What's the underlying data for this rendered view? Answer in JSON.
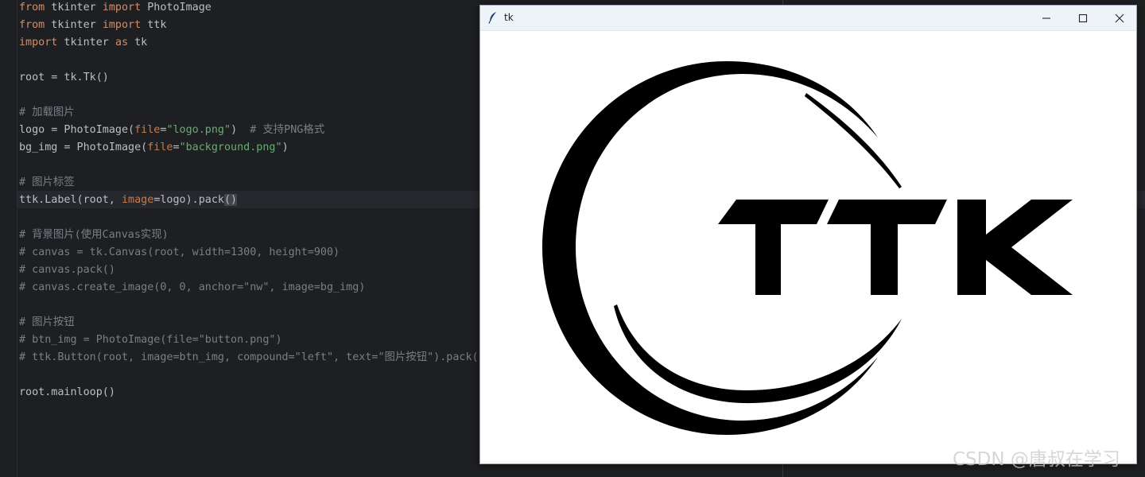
{
  "editor": {
    "lines": [
      [
        {
          "t": "from",
          "c": "kw"
        },
        {
          "t": " tkinter "
        },
        {
          "t": "import",
          "c": "kw"
        },
        {
          "t": " PhotoImage"
        }
      ],
      [
        {
          "t": "from",
          "c": "kw"
        },
        {
          "t": " tkinter "
        },
        {
          "t": "import",
          "c": "kw"
        },
        {
          "t": " ttk"
        }
      ],
      [
        {
          "t": "import",
          "c": "kw"
        },
        {
          "t": " tkinter "
        },
        {
          "t": "as",
          "c": "kw"
        },
        {
          "t": " tk"
        }
      ],
      [],
      [
        {
          "t": "root = tk.Tk()"
        }
      ],
      [],
      [
        {
          "t": "# 加载图片",
          "c": "cmt"
        }
      ],
      [
        {
          "t": "logo = PhotoImage("
        },
        {
          "t": "file",
          "c": "param"
        },
        {
          "t": "="
        },
        {
          "t": "\"logo.png\"",
          "c": "str"
        },
        {
          "t": ")  "
        },
        {
          "t": "# 支持PNG格式",
          "c": "cmt"
        }
      ],
      [
        {
          "t": "bg_img = PhotoImage("
        },
        {
          "t": "file",
          "c": "param"
        },
        {
          "t": "="
        },
        {
          "t": "\"background.png\"",
          "c": "str"
        },
        {
          "t": ")"
        }
      ],
      [],
      [
        {
          "t": "# 图片标签",
          "c": "cmt"
        }
      ],
      [
        {
          "t": "ttk.Label(root, "
        },
        {
          "t": "image",
          "c": "param"
        },
        {
          "t": "=logo).pack"
        },
        {
          "t": "()",
          "c": "brace-hl"
        }
      ],
      [],
      [
        {
          "t": "# 背景图片(使用Canvas实现)",
          "c": "cmt"
        }
      ],
      [
        {
          "t": "# canvas = tk.Canvas(root, width=1300, height=900)",
          "c": "cmt"
        }
      ],
      [
        {
          "t": "# canvas.pack()",
          "c": "cmt"
        }
      ],
      [
        {
          "t": "# canvas.create_image(0, 0, anchor=\"nw\", image=bg_img)",
          "c": "cmt"
        }
      ],
      [],
      [
        {
          "t": "# 图片按钮",
          "c": "cmt"
        }
      ],
      [
        {
          "t": "# btn_img = PhotoImage(file=\"button.png\")",
          "c": "cmt"
        }
      ],
      [
        {
          "t": "# ttk.Button(root, image=btn_img, compound=\"left\", text=\"图片按钮\").pack()",
          "c": "cmt"
        }
      ],
      [],
      [
        {
          "t": "root.mainloop()"
        }
      ]
    ],
    "current_line_index": 11
  },
  "tk_window": {
    "title": "tk",
    "icons": {
      "app": "feather-icon",
      "minimize": "minimize-icon",
      "maximize": "maximize-icon",
      "close": "close-icon"
    },
    "logo_text": "TTK"
  },
  "watermark": "CSDN @唐叔在学习",
  "colors": {
    "editor_bg": "#1e1f22",
    "keyword": "#cf8e6d",
    "string": "#6aab73",
    "comment": "#7a7e85",
    "text": "#bcbec4",
    "logo": "#000000"
  }
}
